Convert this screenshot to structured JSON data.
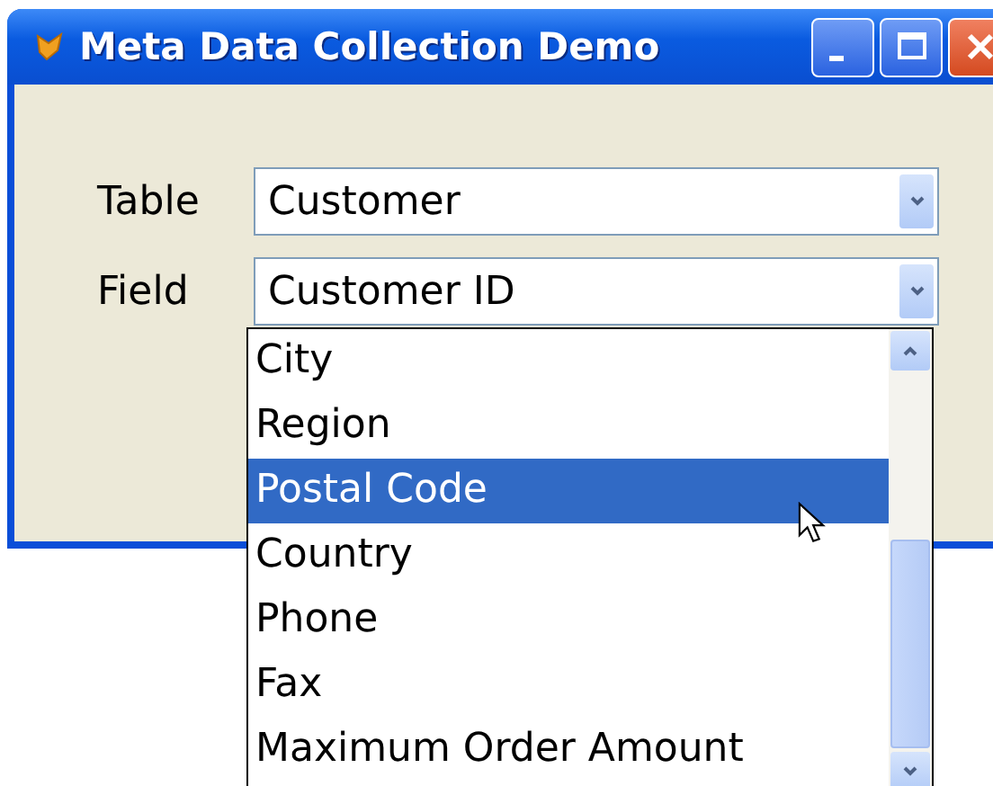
{
  "window": {
    "title": "Meta Data Collection Demo"
  },
  "fields": [
    {
      "label": "Table",
      "value": "Customer"
    },
    {
      "label": "Field",
      "value": "Customer ID"
    }
  ],
  "dropdown": {
    "items": [
      {
        "label": "City",
        "selected": false
      },
      {
        "label": "Region",
        "selected": false
      },
      {
        "label": "Postal Code",
        "selected": true
      },
      {
        "label": "Country",
        "selected": false
      },
      {
        "label": "Phone",
        "selected": false
      },
      {
        "label": "Fax",
        "selected": false
      },
      {
        "label": "Maximum Order Amount",
        "selected": false
      }
    ]
  }
}
